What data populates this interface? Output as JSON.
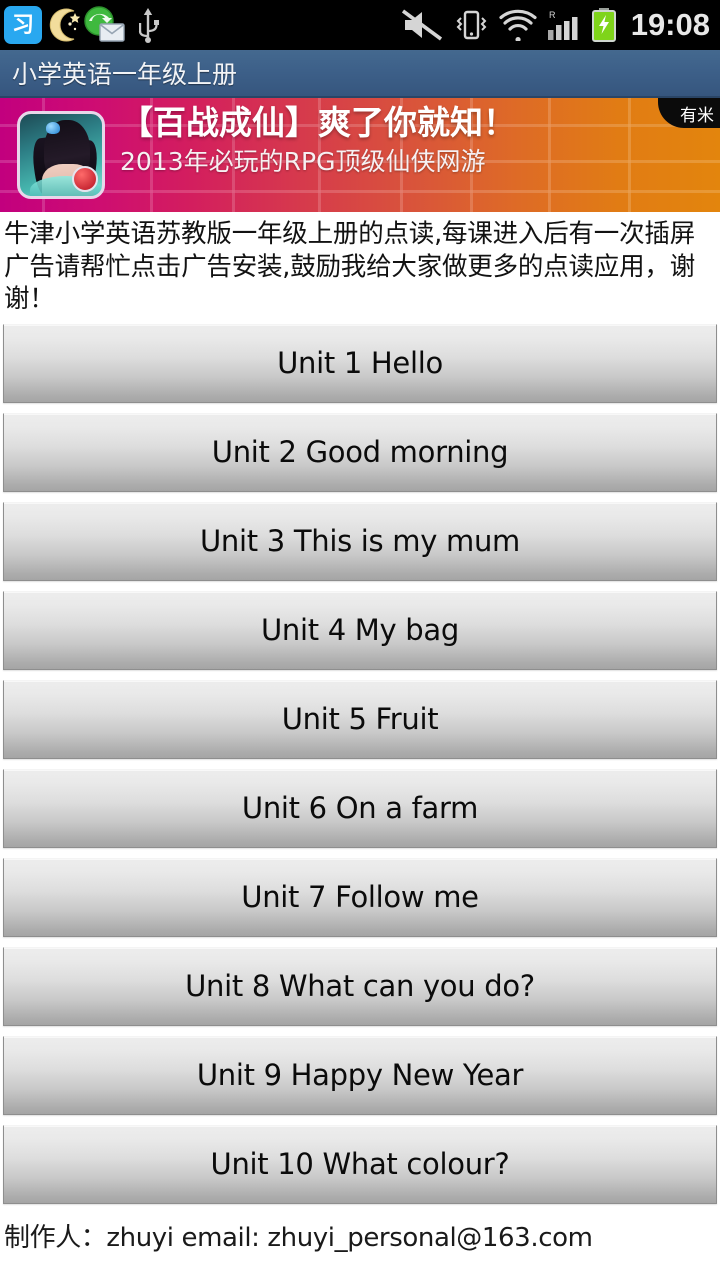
{
  "statusbar": {
    "icons_left": [
      "ime-icon",
      "moon-icon",
      "mail-icon",
      "usb-icon"
    ],
    "icons_right": [
      "mute-icon",
      "vibrate-icon",
      "wifi-icon",
      "signal-icon",
      "battery-charging-icon"
    ],
    "ime_glyph": "习",
    "roaming_label": "R",
    "time": "19:08"
  },
  "titlebar": {
    "title": "小学英语一年级上册"
  },
  "ad": {
    "title": "【百战成仙】爽了你就知！",
    "subtitle": "2013年必玩的RPG顶级仙侠网游",
    "corner_badge": "有米",
    "colors": {
      "left": "#c2007e",
      "mid": "#d63a4c",
      "right": "#e3850d"
    }
  },
  "description": "牛津小学英语苏教版一年级上册的点读,每课进入后有一次插屏广告请帮忙点击广告安装,鼓励我给大家做更多的点读应用，谢谢！",
  "units": [
    {
      "label": "Unit 1 Hello"
    },
    {
      "label": "Unit 2 Good morning"
    },
    {
      "label": "Unit 3 This is my mum"
    },
    {
      "label": "Unit 4 My bag"
    },
    {
      "label": "Unit 5 Fruit"
    },
    {
      "label": "Unit 6 On a farm"
    },
    {
      "label": "Unit 7 Follow me"
    },
    {
      "label": "Unit 8 What can you do?"
    },
    {
      "label": "Unit 9 Happy New Year"
    },
    {
      "label": "Unit 10 What colour?"
    }
  ],
  "footer": {
    "credit": "制作人：zhuyi  email: zhuyi_personal@163.com"
  }
}
